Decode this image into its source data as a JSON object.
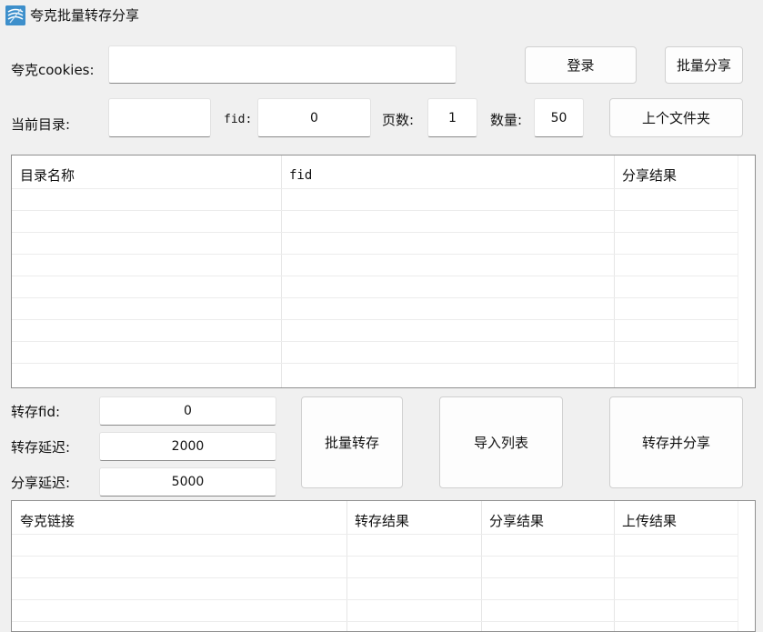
{
  "window": {
    "title": "夸克批量转存分享",
    "icon": "app-logo-icon"
  },
  "login": {
    "cookies_label": "夸克cookies:",
    "cookies_value": "",
    "login_button": "登录",
    "batch_share_button": "批量分享"
  },
  "nav": {
    "current_dir_label": "当前目录:",
    "current_dir_value": "",
    "fid_label": "fid:",
    "fid_value": "0",
    "page_label": "页数:",
    "page_value": "1",
    "count_label": "数量:",
    "count_value": "50",
    "parent_folder_button": "上个文件夹"
  },
  "dir_table": {
    "columns": [
      "目录名称",
      "fid",
      "分享结果"
    ],
    "rows": []
  },
  "transfer": {
    "fid_label": "转存fid:",
    "fid_value": "0",
    "delay_label": "转存延迟:",
    "delay_value": "2000",
    "share_delay_label": "分享延迟:",
    "share_delay_value": "5000",
    "batch_transfer_button": "批量转存",
    "import_list_button": "导入列表",
    "transfer_share_button": "转存并分享"
  },
  "link_table": {
    "columns": [
      "夸克链接",
      "转存结果",
      "分享结果",
      "上传结果"
    ],
    "rows": []
  }
}
